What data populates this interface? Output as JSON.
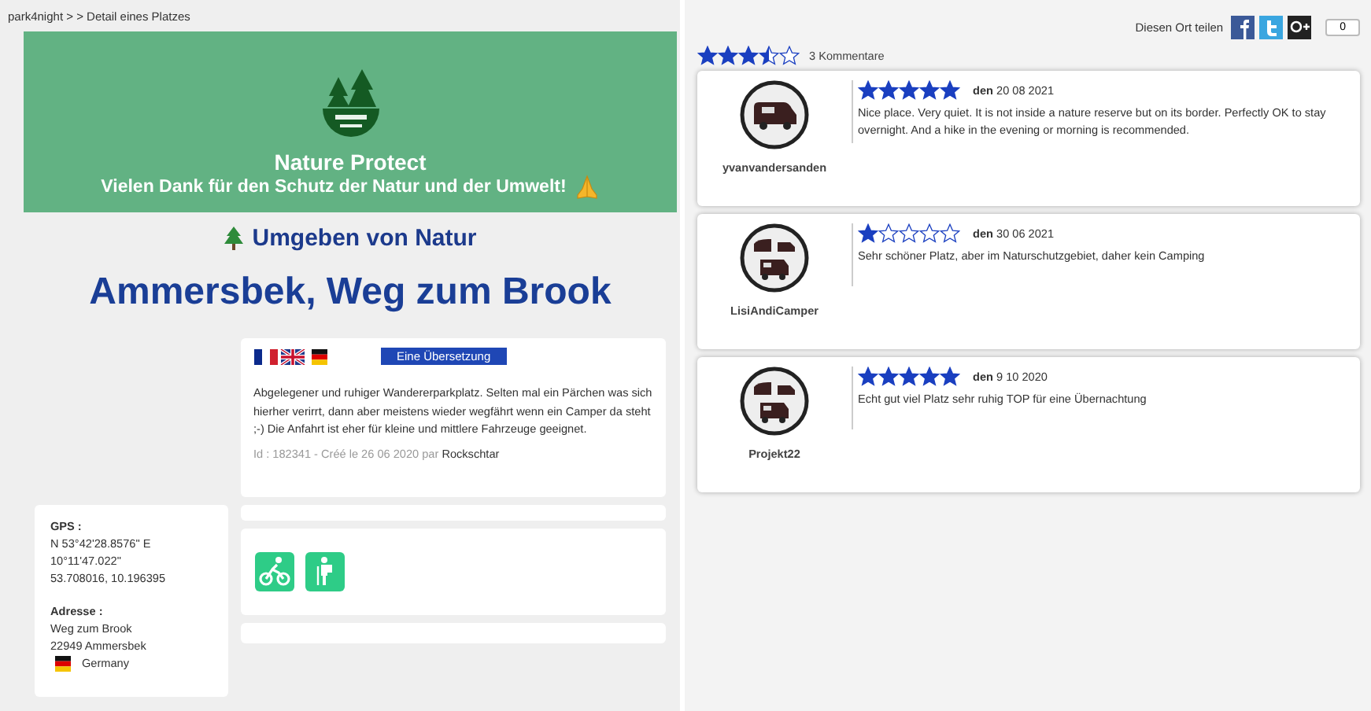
{
  "breadcrumb": "park4night > > Detail eines Platzes",
  "banner": {
    "title": "Nature Protect",
    "subtitle": "Vielen Dank für den Schutz der Natur und der Umwelt!"
  },
  "category": "Umgeben von Natur",
  "place_title": "Ammersbek, Weg zum Brook",
  "translate_button": "Eine Übersetzung",
  "description": "Abgelegener und ruhiger Wandererparkplatz. Selten mal ein Pärchen was sich hierher verirrt, dann aber meistens wieder wegfährt wenn ein Camper da steht ;-) Die Anfahrt ist eher für kleine und mittlere Fahrzeuge geeignet.",
  "meta": {
    "info": "Id : 182341 - Créé le 26 06 2020 par",
    "author": "Rockschtar"
  },
  "gps": {
    "label": "GPS :",
    "lines": [
      "N 53°42'28.8576\" E",
      "10°11'47.022\"",
      "53.708016, 10.196395"
    ]
  },
  "address": {
    "label": "Adresse :",
    "lines": [
      "Weg zum Brook",
      "22949 Ammersbek"
    ],
    "country": "Germany"
  },
  "activities": [
    {
      "kind": "cycling"
    },
    {
      "kind": "hiking"
    }
  ],
  "share": {
    "label": "Diesen Ort teilen",
    "count": "0"
  },
  "rating": {
    "stars": 3.5,
    "count": "3 Kommentare"
  },
  "reviews": [
    {
      "kind": "van",
      "user": "yvanvandersanden",
      "stars": 5,
      "date": "**den** 20 08 2021",
      "text": "Nice place. Very quiet. It is not inside a nature reserve but on its border. Perfectly OK to stay overnight. And a hike in the evening or morning is recommended."
    },
    {
      "kind": "campers",
      "user": "LisiAndiCamper",
      "stars": 1,
      "date": "**den** 30 06 2021",
      "text": "Sehr schöner Platz, aber im Naturschutzgebiet, daher kein Camping"
    },
    {
      "kind": "campers",
      "user": "Projekt22",
      "stars": 5,
      "date": "**den** 9 10 2020",
      "text": "Echt gut viel Platz sehr ruhig TOP für eine Übernachtung"
    }
  ]
}
